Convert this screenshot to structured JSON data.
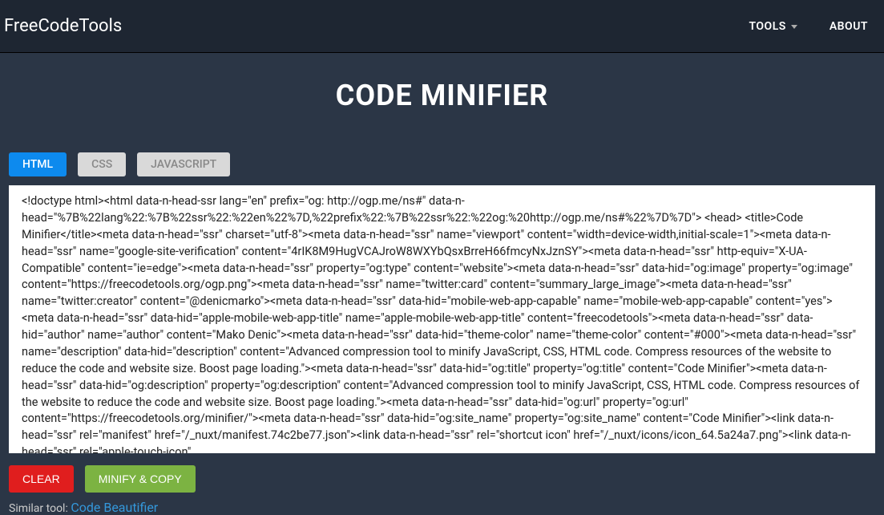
{
  "header": {
    "logo": "FreeCodeTools",
    "nav": {
      "tools": "TOOLS",
      "about": "ABOUT"
    }
  },
  "page": {
    "title": "CODE MINIFIER"
  },
  "tabs": {
    "html": "HTML",
    "css": "CSS",
    "javascript": "JAVASCRIPT"
  },
  "editor": {
    "value": "<!doctype html><html data-n-head-ssr lang=\"en\" prefix=\"og: http://ogp.me/ns#\" data-n-head=\"%7B%22lang%22:%7B%22ssr%22:%22en%22%7D,%22prefix%22:%7B%22ssr%22:%22og:%20http://ogp.me/ns#%22%7D%7D\"> <head> <title>Code Minifier</title><meta data-n-head=\"ssr\" charset=\"utf-8\"><meta data-n-head=\"ssr\" name=\"viewport\" content=\"width=device-width,initial-scale=1\"><meta data-n-head=\"ssr\" name=\"google-site-verification\" content=\"4rIK8M9HugVCAJroW8WXYbQsxBrreH66fmcyNxJznSY\"><meta data-n-head=\"ssr\" http-equiv=\"X-UA-Compatible\" content=\"ie=edge\"><meta data-n-head=\"ssr\" property=\"og:type\" content=\"website\"><meta data-n-head=\"ssr\" data-hid=\"og:image\" property=\"og:image\" content=\"https://freecodetools.org/ogp.png\"><meta data-n-head=\"ssr\" name=\"twitter:card\" content=\"summary_large_image\"><meta data-n-head=\"ssr\" name=\"twitter:creator\" content=\"@denicmarko\"><meta data-n-head=\"ssr\" data-hid=\"mobile-web-app-capable\" name=\"mobile-web-app-capable\" content=\"yes\"><meta data-n-head=\"ssr\" data-hid=\"apple-mobile-web-app-title\" name=\"apple-mobile-web-app-title\" content=\"freecodetools\"><meta data-n-head=\"ssr\" data-hid=\"author\" name=\"author\" content=\"Mako Denic\"><meta data-n-head=\"ssr\" data-hid=\"theme-color\" name=\"theme-color\" content=\"#000\"><meta data-n-head=\"ssr\" name=\"description\" data-hid=\"description\" content=\"Advanced compression tool to minify JavaScript, CSS, HTML code. Compress resources of the website to reduce the code and website size. Boost page loading.\"><meta data-n-head=\"ssr\" data-hid=\"og:title\" property=\"og:title\" content=\"Code Minifier\"><meta data-n-head=\"ssr\" data-hid=\"og:description\" property=\"og:description\" content=\"Advanced compression tool to minify JavaScript, CSS, HTML code. Compress resources of the website to reduce the code and website size. Boost page loading.\"><meta data-n-head=\"ssr\" data-hid=\"og:url\" property=\"og:url\" content=\"https://freecodetools.org/minifier/\"><meta data-n-head=\"ssr\" data-hid=\"og:site_name\" property=\"og:site_name\" content=\"Code Minifier\"><link data-n-head=\"ssr\" rel=\"manifest\" href=\"/_nuxt/manifest.74c2be77.json\"><link data-n-head=\"ssr\" rel=\"shortcut icon\" href=\"/_nuxt/icons/icon_64.5a24a7.png\"><link data-n-head=\"ssr\" rel=\"apple-touch-icon\""
  },
  "buttons": {
    "clear": "CLEAR",
    "minify": "MINIFY & COPY"
  },
  "similar": {
    "label": "Similar tool: ",
    "link": "Code Beautifier"
  }
}
